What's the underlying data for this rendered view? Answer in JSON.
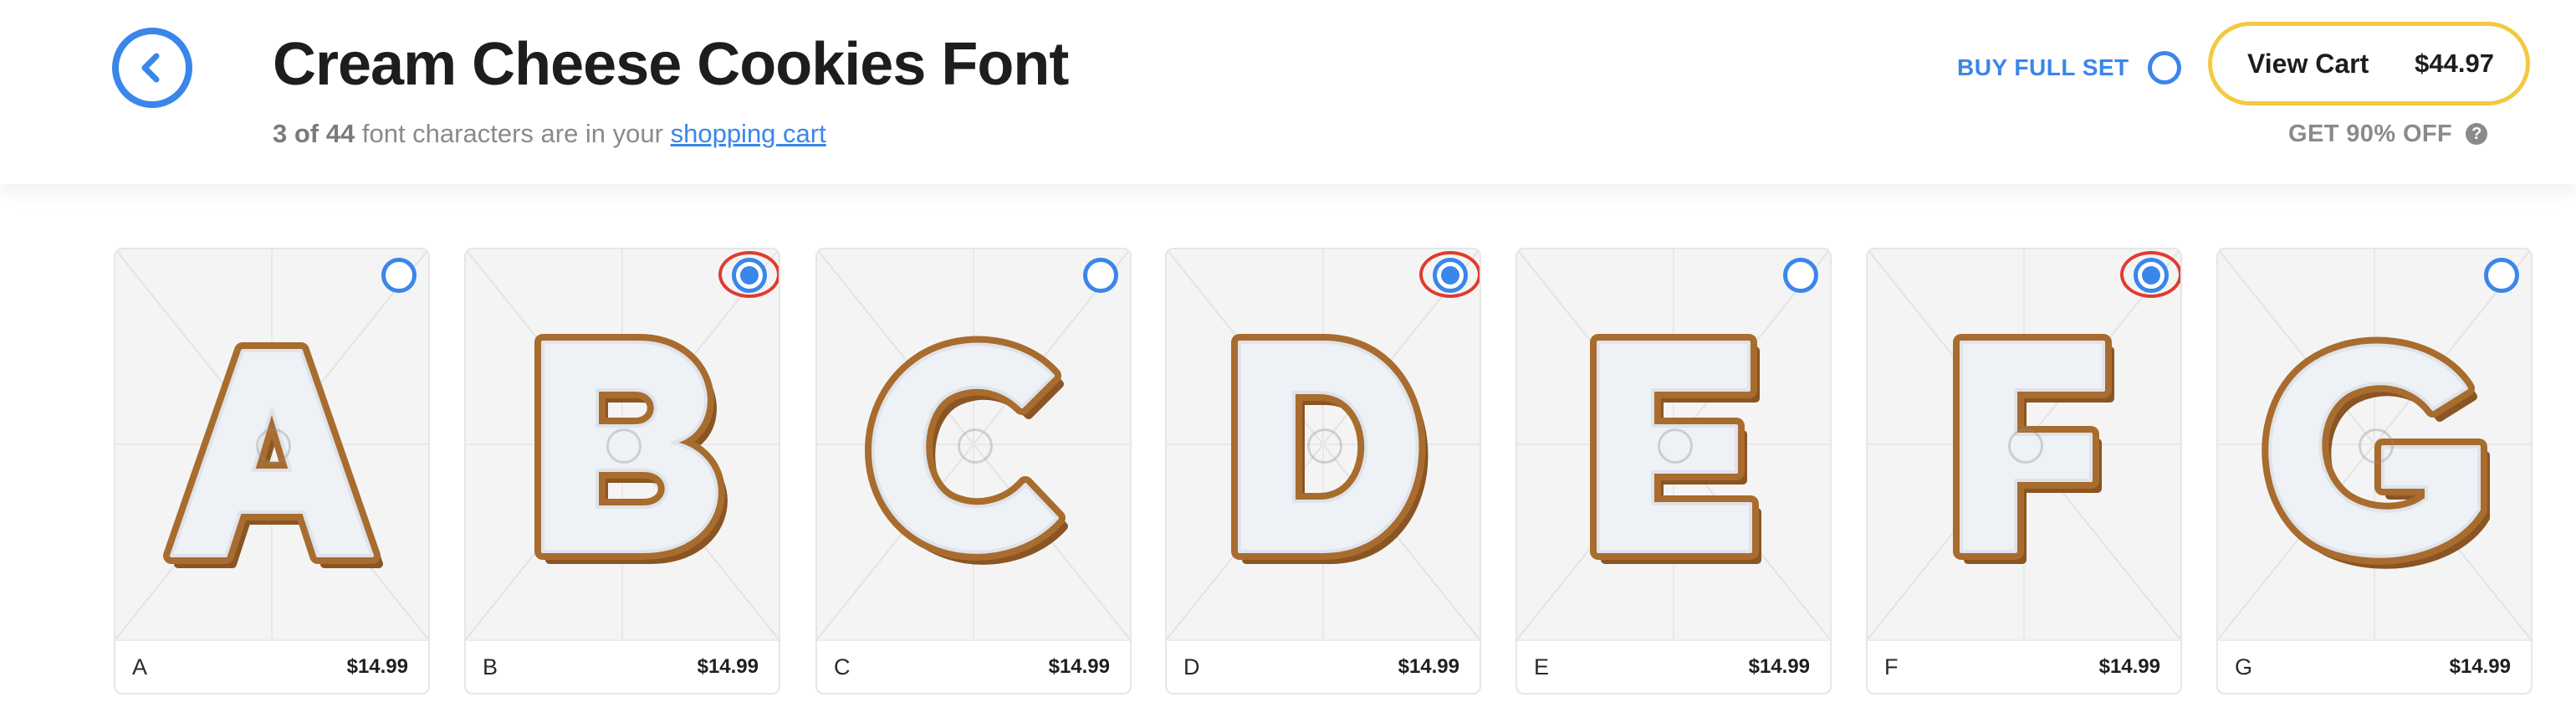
{
  "header": {
    "title": "Cream Cheese Cookies Font",
    "count_text": "3 of 44",
    "subtitle_text": "font characters are in your",
    "cart_link": "shopping cart",
    "buy_full_set": "BUY FULL SET",
    "view_cart_label": "View Cart",
    "cart_total": "$44.97",
    "discount_label": "GET 90% OFF",
    "help_glyph": "?"
  },
  "colors": {
    "accent": "#3a86ea",
    "cart_border": "#f4c842",
    "selection_ring": "#e03c2f",
    "icing": "#eef1f6",
    "cookie": "#b87a38"
  },
  "icons": {
    "back": "chevron-left-icon",
    "help": "question-circle-icon"
  },
  "cards": [
    {
      "letter": "A",
      "name": "A",
      "price": "$14.99",
      "selected": false
    },
    {
      "letter": "B",
      "name": "B",
      "price": "$14.99",
      "selected": true
    },
    {
      "letter": "C",
      "name": "C",
      "price": "$14.99",
      "selected": false
    },
    {
      "letter": "D",
      "name": "D",
      "price": "$14.99",
      "selected": true
    },
    {
      "letter": "E",
      "name": "E",
      "price": "$14.99",
      "selected": false
    },
    {
      "letter": "F",
      "name": "F",
      "price": "$14.99",
      "selected": true
    },
    {
      "letter": "G",
      "name": "G",
      "price": "$14.99",
      "selected": false
    }
  ]
}
